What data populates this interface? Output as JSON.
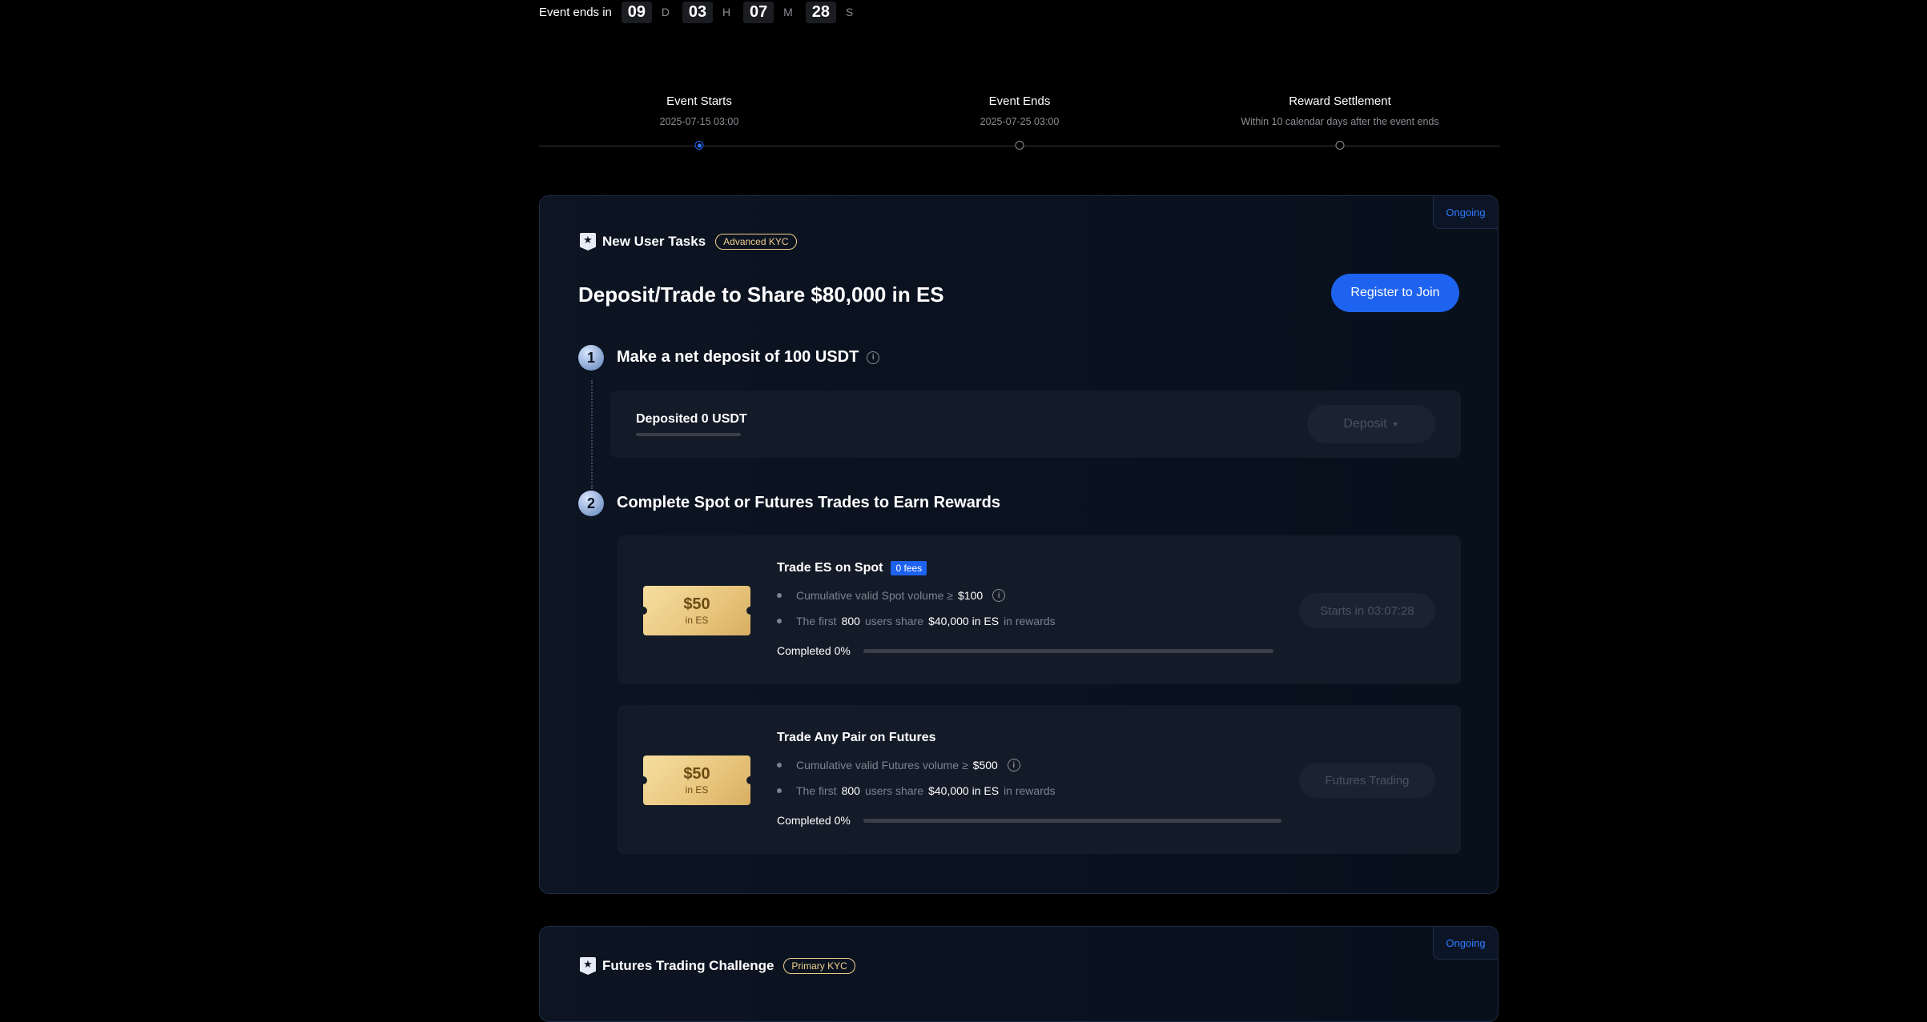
{
  "countdown": {
    "label": "Event ends in",
    "days": "09",
    "days_unit": "D",
    "hours": "03",
    "hours_unit": "H",
    "minutes": "07",
    "minutes_unit": "M",
    "seconds": "28",
    "seconds_unit": "S"
  },
  "timeline": [
    {
      "title": "Event Starts",
      "sub": "2025-07-15 03:00"
    },
    {
      "title": "Event Ends",
      "sub": "2025-07-25 03:00"
    },
    {
      "title": "Reward Settlement",
      "sub": "Within 10 calendar days after the event ends"
    }
  ],
  "card1": {
    "status": "Ongoing",
    "task_name": "New User Tasks",
    "kyc": "Advanced KYC",
    "title": "Deposit/Trade to Share $80,000 in ES",
    "register_label": "Register to Join",
    "step1": {
      "num": "1",
      "title": "Make a net deposit of 100 USDT",
      "deposited": "Deposited 0 USDT",
      "deposit_button": "Deposit"
    },
    "step2": {
      "num": "2",
      "title": "Complete Spot or Futures Trades to Earn Rewards"
    },
    "spot": {
      "ticket_amount": "$50",
      "ticket_unit": "in ES",
      "title": "Trade ES on Spot",
      "fee_badge": "0 fees",
      "line1_prefix": "Cumulative valid Spot volume ≥",
      "line1_value": "$100",
      "line2_a": "The first",
      "line2_users": "800",
      "line2_b": "users share",
      "line2_amount": "$40,000 in ES",
      "line2_c": "in rewards",
      "completed": "Completed 0%",
      "progress": 0,
      "button": "Starts in 03:07:28"
    },
    "futures": {
      "ticket_amount": "$50",
      "ticket_unit": "in ES",
      "title": "Trade Any Pair on Futures",
      "line1_prefix": "Cumulative valid Futures volume ≥",
      "line1_value": "$500",
      "line2_a": "The first",
      "line2_users": "800",
      "line2_b": "users share",
      "line2_amount": "$40,000 in ES",
      "line2_c": "in rewards",
      "completed": "Completed 0%",
      "progress": 0,
      "button": "Futures Trading"
    }
  },
  "card2": {
    "status": "Ongoing",
    "task_name": "Futures Trading Challenge",
    "kyc": "Primary KYC"
  },
  "colors": {
    "accent": "#1e63f0",
    "gold": "#f0cf8a"
  }
}
